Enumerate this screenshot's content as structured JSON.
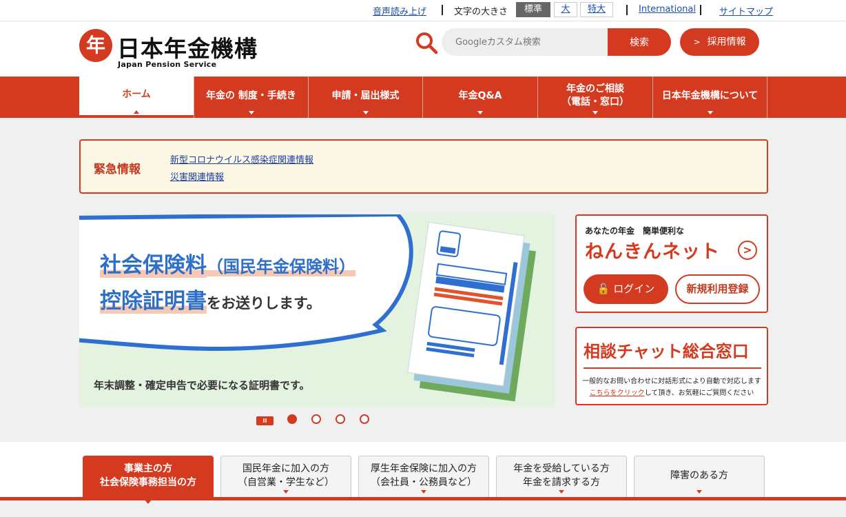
{
  "topbar": {
    "read_aloud": "音声読み上げ",
    "font_size_label": "文字の大きさ",
    "font_sizes": [
      "標準",
      "大",
      "特大"
    ],
    "international": "International",
    "sitemap": "サイトマップ"
  },
  "header": {
    "logo_mark": "年",
    "logo_text": "日本年金機構",
    "logo_sub": "Japan Pension Service",
    "search_placeholder": "Googleカスタム検索",
    "search_button": "検索",
    "recruit_button": "採用情報"
  },
  "nav": {
    "items": [
      "ホーム",
      "年金の 制度・手続き",
      "申請・届出様式",
      "年金Q&A",
      "年金のご相談\n（電話・窓口）",
      "日本年金機構について"
    ]
  },
  "emergency": {
    "title": "緊急情報",
    "links": [
      "新型コロナウイルス感染症関連情報",
      "災害関連情報"
    ]
  },
  "banner": {
    "line1_main": "社会保険料",
    "line1_paren": "（国民年金保険料）",
    "line2_main": "控除証明書",
    "line2_tail": "をお送りします。",
    "footer": "年末調整・確定申告で必要になる証明書です。",
    "pause_label": "II"
  },
  "nenkin_net": {
    "subtitle": "あなたの年金　簡単便利な",
    "title": "ねんきんネット",
    "login": "ログイン",
    "register": "新規利用登録"
  },
  "chat": {
    "title": "相談チャット総合窓口",
    "desc1": "一般的なお問い合わせに対話形式により自動で対応します",
    "desc2_link": "こちらをクリック",
    "desc2_tail": "して頂き、お気軽にご質問ください"
  },
  "tabs": [
    "事業主の方\n社会保険事務担当の方",
    "国民年金に加入の方\n（自営業・学生など）",
    "厚生年金保険に加入の方\n（会社員・公務員など）",
    "年金を受給している方\n年金を請求する方",
    "障害のある方"
  ],
  "colors": {
    "brand_red": "#d33a1f",
    "banner_blue": "#2e6fc8",
    "banner_bg": "#e3f3e0",
    "emergency_bg": "#fdf8e6"
  }
}
